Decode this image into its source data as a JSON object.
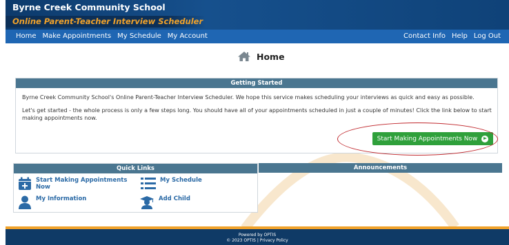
{
  "header": {
    "school_name": "Byrne Creek Community School",
    "tagline": "Online Parent-Teacher Interview Scheduler"
  },
  "nav": {
    "left": [
      "Home",
      "Make Appointments",
      "My Schedule",
      "My Account"
    ],
    "right": [
      "Contact Info",
      "Help",
      "Log Out"
    ]
  },
  "page": {
    "title": "Home",
    "title_icon": "home-icon"
  },
  "getting_started": {
    "heading": "Getting Started",
    "paragraph1": "Byrne Creek Community School's Online Parent-Teacher Interview Scheduler. We hope this service makes scheduling your interviews as quick and easy as possible.",
    "paragraph2": "Let's get started - the whole process is only a few steps long. You should have all of your appointments scheduled in just a couple of minutes! Click the link below to start making appointments now.",
    "button_label": "Start Making Appointments Now"
  },
  "quick_links": {
    "heading": "Quick Links",
    "items": [
      {
        "label": "Start Making Appointments Now",
        "icon": "calendar-plus-icon"
      },
      {
        "label": "My Schedule",
        "icon": "list-icon"
      },
      {
        "label": "My Information",
        "icon": "user-icon"
      },
      {
        "label": "Add Child",
        "icon": "graduate-icon"
      }
    ]
  },
  "announcements": {
    "heading": "Announcements"
  },
  "footer": {
    "powered_by": "Powered by OPTIS",
    "copyright": "© 2023 OPTIS  |  Privacy Policy"
  },
  "colors": {
    "header_dark": "#0d3a6b",
    "nav_blue": "#1f66b3",
    "tagline_orange": "#f0a22b",
    "panel_head": "#4a7690",
    "button_green": "#2fa03b",
    "link_blue": "#2b6aa6",
    "highlight_red": "#c0282d"
  }
}
